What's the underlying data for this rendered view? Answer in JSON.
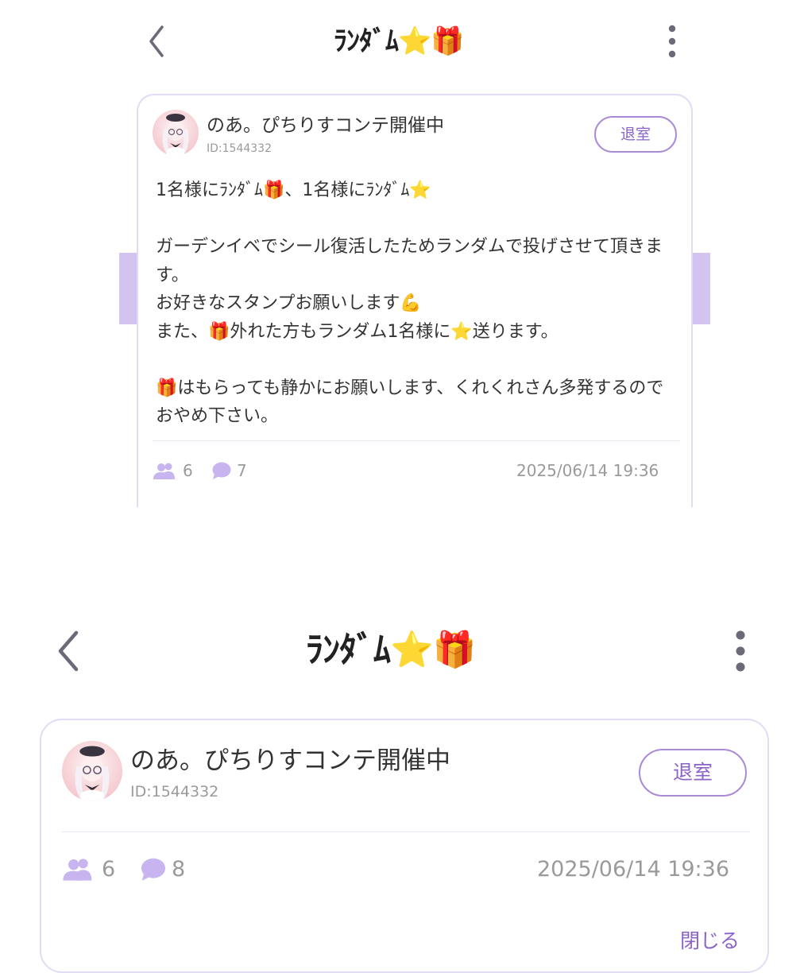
{
  "colors": {
    "accent": "#8a63c9",
    "accent_border": "#a88ad6",
    "accent_light": "#c8b4ee",
    "side_tab": "#d2c4ee",
    "muted_text": "#9a9a9a"
  },
  "top_screen": {
    "header": {
      "title": "ﾗﾝﾀﾞﾑ⭐🎁",
      "back_icon": "chevron-left-icon",
      "menu_icon": "more-vertical-icon"
    },
    "room": {
      "host_name": "のあ。ぴちりすコンテ開催中",
      "host_id": "ID:1544332",
      "exit_label": "退室",
      "description_lines": [
        "1名様にﾗﾝﾀﾞﾑ🎁、1名様にﾗﾝﾀﾞﾑ⭐",
        "",
        "ガーデンイベでシール復活したためランダムで投げさせて頂きます。",
        "お好きなスタンプお願いします💪",
        "また、🎁外れた方もランダム1名様に⭐送ります。",
        "",
        "🎁はもらっても静かにお願いします、くれくれさん多発するのでおやめ下さい。"
      ],
      "member_count": "6",
      "comment_count": "7",
      "created_at": "2025/06/14 19:36"
    }
  },
  "bottom_screen": {
    "header": {
      "title": "ﾗﾝﾀﾞﾑ⭐🎁",
      "back_icon": "chevron-left-icon",
      "menu_icon": "more-vertical-icon"
    },
    "room": {
      "host_name": "のあ。ぴちりすコンテ開催中",
      "host_id": "ID:1544332",
      "exit_label": "退室",
      "member_count": "6",
      "comment_count": "8",
      "created_at": "2025/06/14 19:36",
      "close_label": "閉じる"
    }
  }
}
